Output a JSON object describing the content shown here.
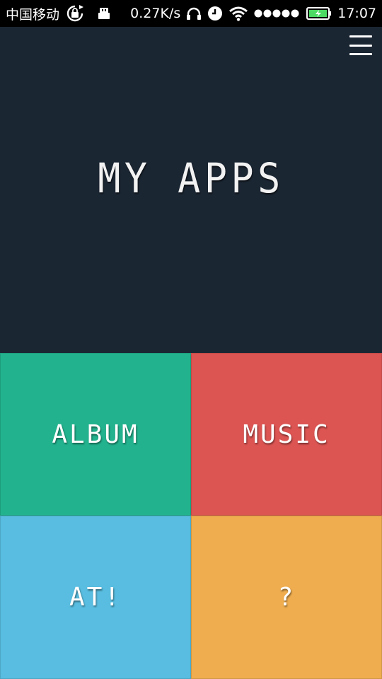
{
  "status_bar": {
    "carrier": "中国移动",
    "speed": "0.27K/s",
    "time": "17:07",
    "icons": [
      "rotation-lock-icon",
      "usb-icon",
      "headphones-icon",
      "alarm-icon",
      "wifi-icon",
      "signal-icon",
      "battery-icon"
    ]
  },
  "header": {
    "title": "MY APPS",
    "menu_icon": "hamburger-menu-icon"
  },
  "tiles": [
    {
      "label": "ALBUM",
      "color": "#22b38e"
    },
    {
      "label": "MUSIC",
      "color": "#dc5553"
    },
    {
      "label": "AT!",
      "color": "#58bde0"
    },
    {
      "label": "?",
      "color": "#efad4f"
    }
  ],
  "colors": {
    "header_bg": "#1b2633",
    "status_bg": "#000000"
  }
}
